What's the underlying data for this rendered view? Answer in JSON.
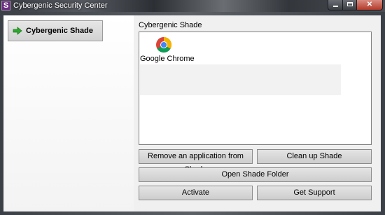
{
  "window": {
    "app_icon_letter": "S",
    "title": "Cybergenic Security Center",
    "controls": [
      "minimize",
      "maximize",
      "close"
    ]
  },
  "sidebar": {
    "items": [
      {
        "label": "Cybergenic Shade",
        "icon": "green-arrow-icon",
        "selected": true
      }
    ]
  },
  "main": {
    "section_title": "Cybergenic Shade",
    "apps": [
      {
        "label": "Google Chrome",
        "icon": "chrome-icon"
      }
    ],
    "buttons": {
      "remove": "Remove an application from Shade",
      "cleanup": "Clean up Shade",
      "open_folder": "Open Shade Folder",
      "activate": "Activate",
      "support": "Get Support"
    }
  },
  "colors": {
    "accent_arrow": "#2ea82e",
    "app_icon_bg": "#6b2d82",
    "close_button": "#c24a3a"
  }
}
